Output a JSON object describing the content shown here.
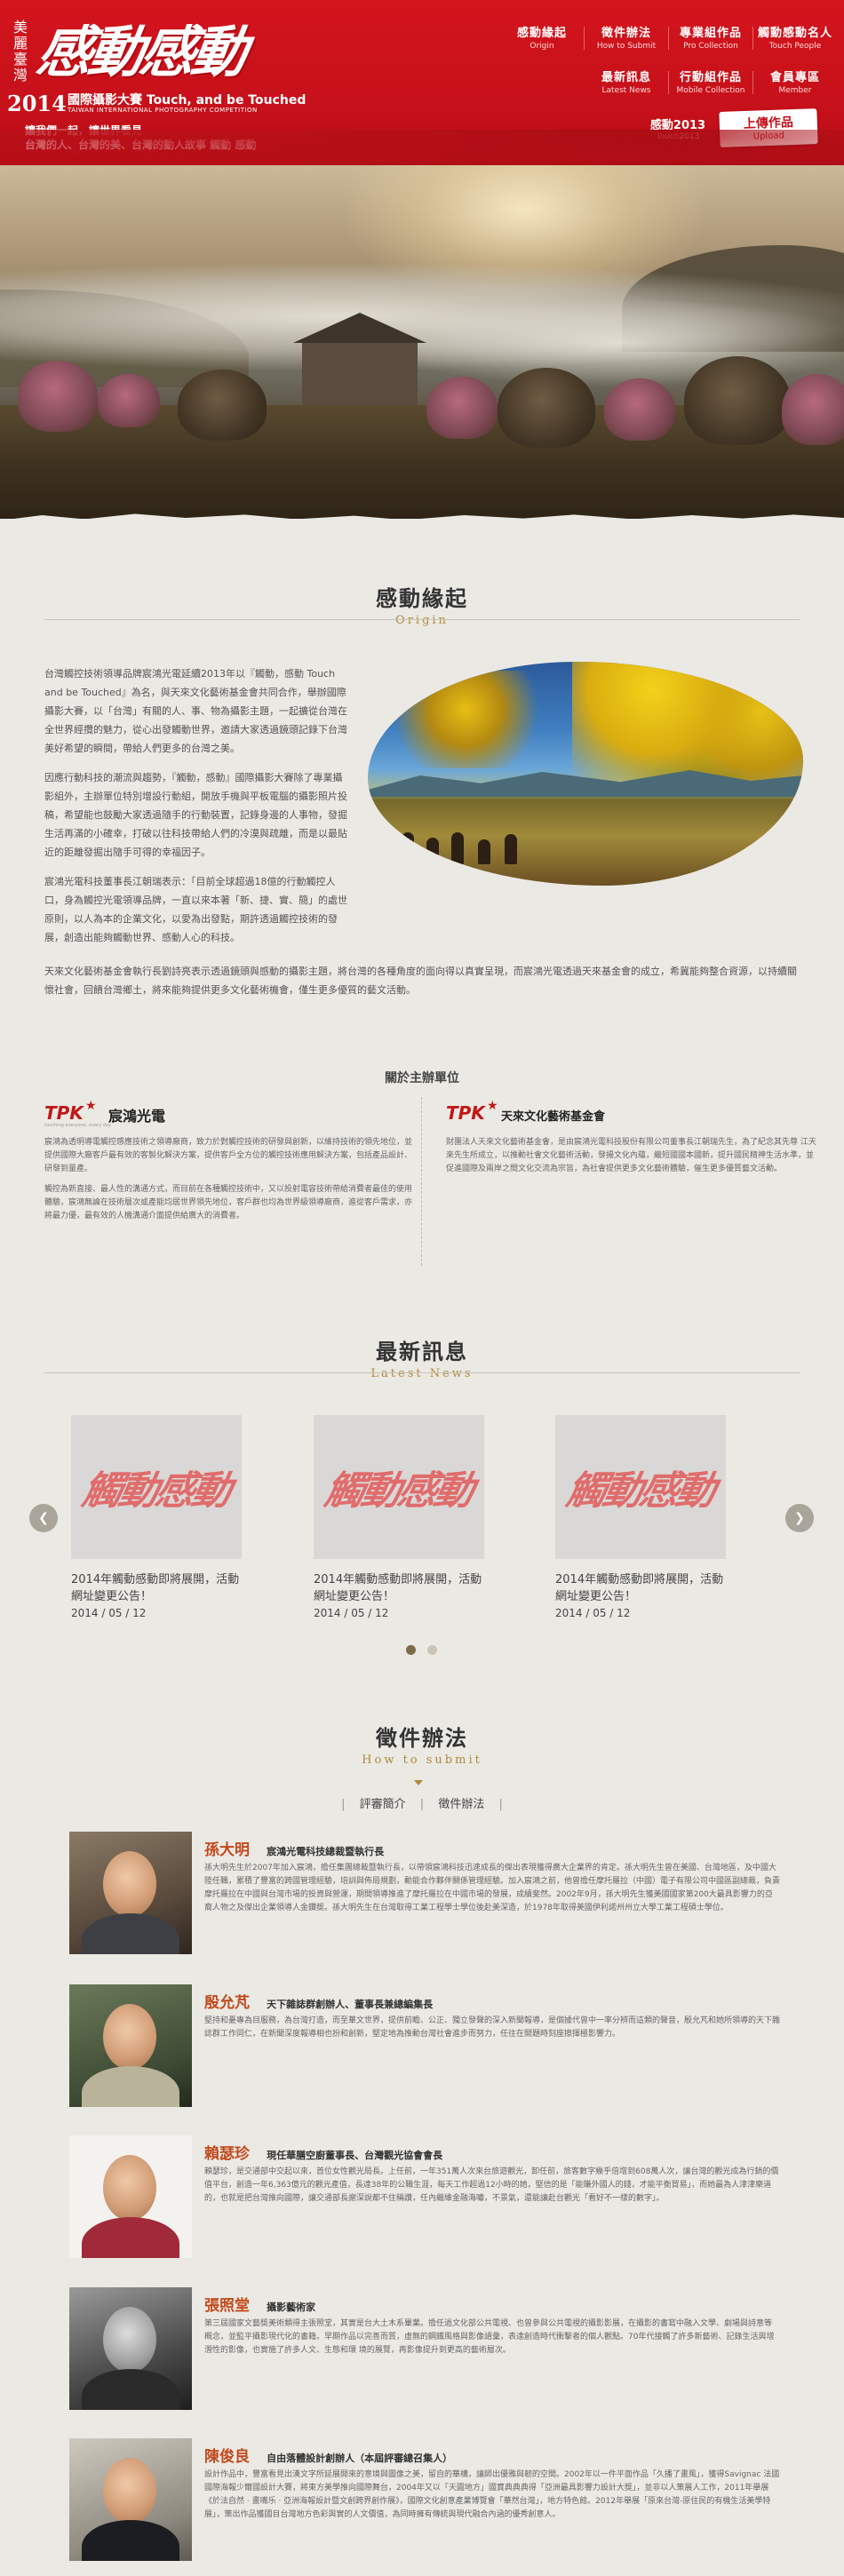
{
  "header": {
    "vertical_mark": "美麗臺灣",
    "calligraphy": "感動感動",
    "year": "2014",
    "competition_zh": "國際攝影大賽 Touch, and be Touched",
    "competition_en": "TAIWAN INTERNATIONAL PHOTOGRAPHY COMPETITION",
    "slogan_1": "讓我們一起，讓世界看見",
    "slogan_2": "台灣的人、台灣的美、台灣的動人故事  觸動 感動",
    "nav": [
      {
        "zh": "感動緣起",
        "en": "Origin"
      },
      {
        "zh": "徵件辦法",
        "en": "How to Submit"
      },
      {
        "zh": "專業組作品",
        "en": "Pro Collection"
      },
      {
        "zh": "觸動感動名人",
        "en": "Touch People"
      },
      {
        "zh": "最新訊息",
        "en": "Latest News"
      },
      {
        "zh": "行動組作品",
        "en": "Mobile Collection"
      },
      {
        "zh": "會員專區",
        "en": "Member"
      }
    ],
    "touch2013_zh": "感動2013",
    "touch2013_en": "Touch2013",
    "upload_zh": "上傳作品",
    "upload_en": "Upload"
  },
  "origin": {
    "title_zh": "感動緣起",
    "title_en": "Origin",
    "paragraphs": [
      "台灣觸控技術領導品牌宸鴻光電延續2013年以『觸動，感動 Touch and be Touched』為名，與天來文化藝術基金會共同合作，舉辦國際攝影大賽，以「台灣」有關的人、事、物為攝影主題，一起擴從台灣在全世界經攬的魅力，從心出發觸動世界，邀請大家透過鏡頭記錄下台灣美好希望的瞬間，帶給人們更多的台灣之美。",
      "因應行動科技的潮流與趨勢，『觸動，感動』國際攝影大賽除了專業攝影組外，主辦單位特別增設行動組，開放手機與平板電腦的攝影照片投稿，希望能也鼓勵大家透過隨手的行動裝置，記錄身邊的人事物，發掘生活再滿的小確幸，打破以往科技帶給人們的冷漠與疏離，而是以最貼近的距離發掘出隨手可得的幸福因子。",
      "宸鴻光電科技董事長江朝瑞表示：「目前全球超過18億的行動觸控人口，身為觸控光電領導品牌，一直以來本著「新、捷、實、簡」的處世原則，以人為本的企業文化，以愛為出發點，期許透過觸控技術的發展，創造出能夠觸動世界、感動人心的科技。"
    ],
    "paragraph_wide": "天來文化藝術基金會執行長劉詩亮表示透過鏡頭與感動的攝影主題，將台灣的各種角度的面向得以真實呈現，而宸鴻光電透過天來基金會的成立，希冀能夠整合資源，以持續關懷社會，回饋台灣鄉土，將來能夠提供更多文化藝術機會，僅生更多優質的藝文活動。"
  },
  "sponsors": {
    "title": "關於主辦單位",
    "tpk": {
      "mark": "TPK",
      "name": "宸鴻光電",
      "tagline": "touching everyone, every day",
      "paragraphs": [
        "宸鴻為透明導電觸控感應技術之領導廠商，致力於對觸控技術的研發與創新，以維持技術的領先地位，並提供國際大廠客戶最有效的客製化解決方案，提供客戶全方位的觸控技術應用解決方案，包括產品設計、研發到量產。",
        "觸控為新直接、最人性的溝通方式，而目前在各種觸控技術中，又以投射電容技術帶給消費者最佳的使用體驗，宸鴻無論在技術層次或產能均居世界領先地位，客戶群也均為世界級領導廠商，進從客戶需求，亦將最力優，最有效的人機溝通介面提供給廣大的消費者。"
      ]
    },
    "tianlai": {
      "mark": "TPK",
      "name": "天來文化藝術基金會",
      "paragraphs": [
        "財團法人天來文化藝術基金會，是由宸鴻光電科技股份有限公司董事長江朝瑞先生，為了紀念其先尊 江天來先生所成立，以推動社會文化藝術活動，發揚文化內蘊，繼短國國本國新，提升國民精神生活水準，並促進國際及兩岸之間文化交流為宗旨，為社會提供更多文化藝術體驗，催生更多優質藝文活動。"
      ]
    }
  },
  "news": {
    "title_zh": "最新訊息",
    "title_en": "Latest News",
    "items": [
      {
        "text": "2014年觸動感動即將展開，活動網址變更公告！",
        "date": "2014 / 05 / 12",
        "thumb": "觸動感動"
      },
      {
        "text": "2014年觸動感動即將展開，活動網址變更公告！",
        "date": "2014 / 05 / 12",
        "thumb": "觸動感動"
      },
      {
        "text": "2014年觸動感動即將展開，活動網址變更公告！",
        "date": "2014 / 05 / 12",
        "thumb": "觸動感動"
      }
    ],
    "prev_icon": "chevron-left-icon",
    "next_icon": "chevron-right-icon"
  },
  "submit": {
    "title_zh": "徵件辦法",
    "title_en": "How to submit",
    "tabs": [
      "評審簡介",
      "徵件辦法"
    ],
    "judges": [
      {
        "name": "孫大明",
        "title": "宸鴻光電科技總裁暨執行長",
        "bio": "孫大明先生於2007年加入宸鴻，擔任集團總裁暨執行長，以帶領宸鴻科技迅速成長的傑出表現獲得廣大企業界的肯定。孫大明先生曾在美國、台灣地區，及中國大陸任職，累積了豐富的跨國管理經驗，培訓與佈局規劃，動能合作夥伴關係管理經驗。加入宸鴻之前，他曾擔任摩托羅拉（中國）電子有限公司中國區副總裁，負責摩托羅拉在中國與台灣市場的投資與營運，期間領導推進了摩托羅拉在中國市場的發展，成績斐然。2002年9月，孫大明先生獲美國國家第200大最具影響力的亞裔人物之及傑出企業領導人金鑽獎。孫大明先生在台灣取得工業工程學士學位後赴美深造，於1978年取得美國伊利諾州州立大學工業工程碩士學位。",
        "tone": "warm"
      },
      {
        "name": "殷允芃",
        "title": "天下雜誌群創辦人、董事長兼總編集長",
        "bio": "堅持和憂專為目服務，為台灣打造，而至華文世界，提供前瞻、公正、獨立發聲的深入新聞報導，是個據代曾中一率分辨而這類的聲音，殷允芃和她所領導的天下雜誌群工作同仁，在新聞深度報導相也扮和創新，堅定地為推動台灣社會進步而努力，任往在開題時刻座擦揮極影響力。",
        "tone": "warm"
      },
      {
        "name": "賴瑟珍",
        "title": "現任華膳空廚董事長、台灣觀光協會會長",
        "bio": "賴瑟珍，是交通部中交起以來，首位女性觀光局長。上任前，一年351萬人次來台旅遊觀光，卸任前，旅客數字幾乎倍增到608萬人次，讓台灣的觀光成為行銷的價值平台，創造一年6,363億元的觀光產值，長達38年的公職生涯，每天工作超過12小時的她，堅信的是「能賺外國人的錢，才能平衡貿易」，而她最為人津津樂道的，也就是把台灣推向國際，讓交通部長謝深說都不住稱讚，任內繼維金融海嘯，不景氣，還能讓赴台觀光「看好不一樣的數字」。",
        "tone": "light"
      },
      {
        "name": "張照堂",
        "title": "攝影藝術家",
        "bio": "第三屆國家文藝獎美術類得主張照堂，其實是台大土木系畢業。擔任過文化部公共電視、也曾參與公共電視的攝影影展，在攝影的書寫中融入文學、劇場與詩意等 概念，並監平攝影現代化的書籍。早期作品以完善而質，虛無的鋼鐵風格與影像語彙，表達創造時代衝擊者的個人觀點。70年代接觸了許多新藝術、記錄生活與增潛性的影像，也實施了許多人文、生態和環 境的展覽，再影像提升到更高的藝術層次。",
        "tone": "bw"
      },
      {
        "name": "陳俊良",
        "title": "自由落體設計創辦人（本屆評審總召集人）",
        "bio": "設計作品中，豐富看見出漢文字所延展開來的意境與圖像之美，留自的華構，讓師出優雅與韌的空間。2002年以一件平面作品「久播了畫風」，獲得Savignac 法國國際海報少爾國設計大賽，將東方美學推向國際舞台，2004年又以「天圓地方」國寶典典典得「亞洲最具影響力設計大獎」，並非以人策展人工作，2011年舉展《於法自然 ‧ 畫嘴乐 ‧ 亞洲海報設計暨文創跨界創作展》，國際文化創意產業博覽會「華然台灣」，地方特色館。2012年舉展「原來台灣-原住民的有機生活美學特展」，策出作品獲國目台灣地方色彩與實的人文價值，為同時擁有傳統與現代融合內涵的優秀創意人。",
        "tone": "warm"
      }
    ]
  }
}
